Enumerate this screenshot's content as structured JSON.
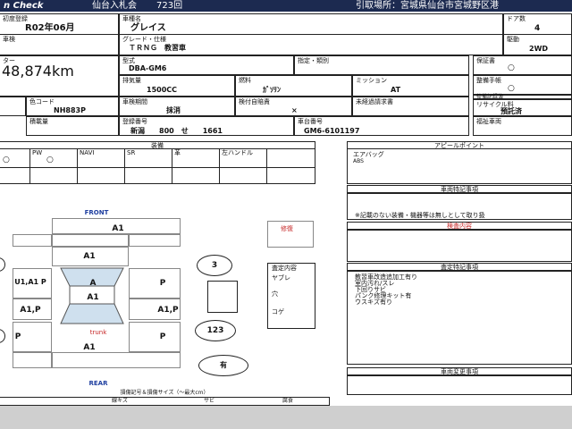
{
  "header": {
    "brand": "n Check",
    "venue": "仙台入札会",
    "session": "723回",
    "pickup": "引取場所：宮城県仙台市宮城野区港"
  },
  "row1": {
    "first_reg_label": "初度登録",
    "first_reg_value": "R02年06月",
    "car_name_label": "車種名",
    "car_name_value": "グレイス",
    "doors_label": "ドア数",
    "doors_value": "4",
    "inspection_label": "車検",
    "grade_label": "グレード・仕様",
    "grade_value": "ＴＲＮＧ　教習車",
    "drive_label": "駆動",
    "drive_value": "2WD"
  },
  "row2": {
    "mileage_label": "ター",
    "mileage_value": "48,874km",
    "model_label": "型式",
    "model_value": "DBA-GM6",
    "designation_label": "指定・類別",
    "warranty_label": "保証書",
    "warranty_value": "○",
    "displacement_label": "排気量",
    "displacement_value": "1500CC",
    "fuel_label": "燃料",
    "fuel_value": "ｶﾞｿﾘﾝ",
    "mission_label": "ミッション",
    "mission_value": "AT",
    "manual_label": "整備手帳",
    "manual_value": "○",
    "maint_label": "整備記録簿"
  },
  "row3": {
    "color_label": "色コード",
    "color_value": "NH883P",
    "inspection_period_label": "車検期間",
    "inspection_period_value": "抹消",
    "insurance_label": "検付自賠責",
    "insurance_value": "×",
    "tax_label": "未経過請求書",
    "recycle_label": "リサイクル料",
    "recycle_value": "預託済",
    "capacity_label": "積載量",
    "plate_label": "登録番号",
    "plate_value": "新潟　　800　せ　　1661",
    "chassis_label": "車台番号",
    "chassis_value": "GM6-6101197",
    "welfare_label": "福祉車両"
  },
  "equipment": {
    "title": "装備",
    "items": [
      "PW",
      "NAVI",
      "SR",
      "革",
      "左ハンドル"
    ],
    "marks": [
      "○",
      "○",
      "",
      "",
      "",
      ""
    ]
  },
  "appeal": {
    "title": "アピールポイント",
    "lines": [
      "エアバッグ",
      "ABS"
    ]
  },
  "vehicle_notes": {
    "title": "車両特記事項",
    "note": "※記載のない装備・機器等は無しとして取り扱",
    "inspection_title": "検査内容"
  },
  "map": {
    "front": "FRONT",
    "rear": "REAR",
    "trunk": "trunk",
    "zones": [
      "A1",
      "A1",
      "A1",
      "A",
      "A1",
      "U1,A1 P",
      "P",
      "A1,P",
      "A1,P",
      "P",
      "P",
      "A1"
    ],
    "circles": [
      "3",
      "123",
      "有"
    ],
    "legend": "損傷記号＆損傷サイズ（～最大cm）",
    "legend_items": [
      "",
      "線キズ",
      "",
      "サビ",
      "",
      "腐食"
    ]
  },
  "side_boxes": {
    "red_label": "修復",
    "tire_title": "査定内容",
    "tire_items": [
      "ヤブレ",
      "穴",
      "コゲ"
    ]
  },
  "assessment": {
    "title": "査定特記事項",
    "lines": [
      "教習車改造追加工有り",
      "室内汚れ/スレ",
      "下回りサビ",
      "パンク修理キット有",
      "ウスキズ有り"
    ]
  },
  "history": {
    "title": "車両変更事項"
  },
  "colors": {
    "topbar": "#1c2a50",
    "red": "#c62828",
    "blue": "#1f3fa0",
    "panel": "#bfbfbf"
  }
}
